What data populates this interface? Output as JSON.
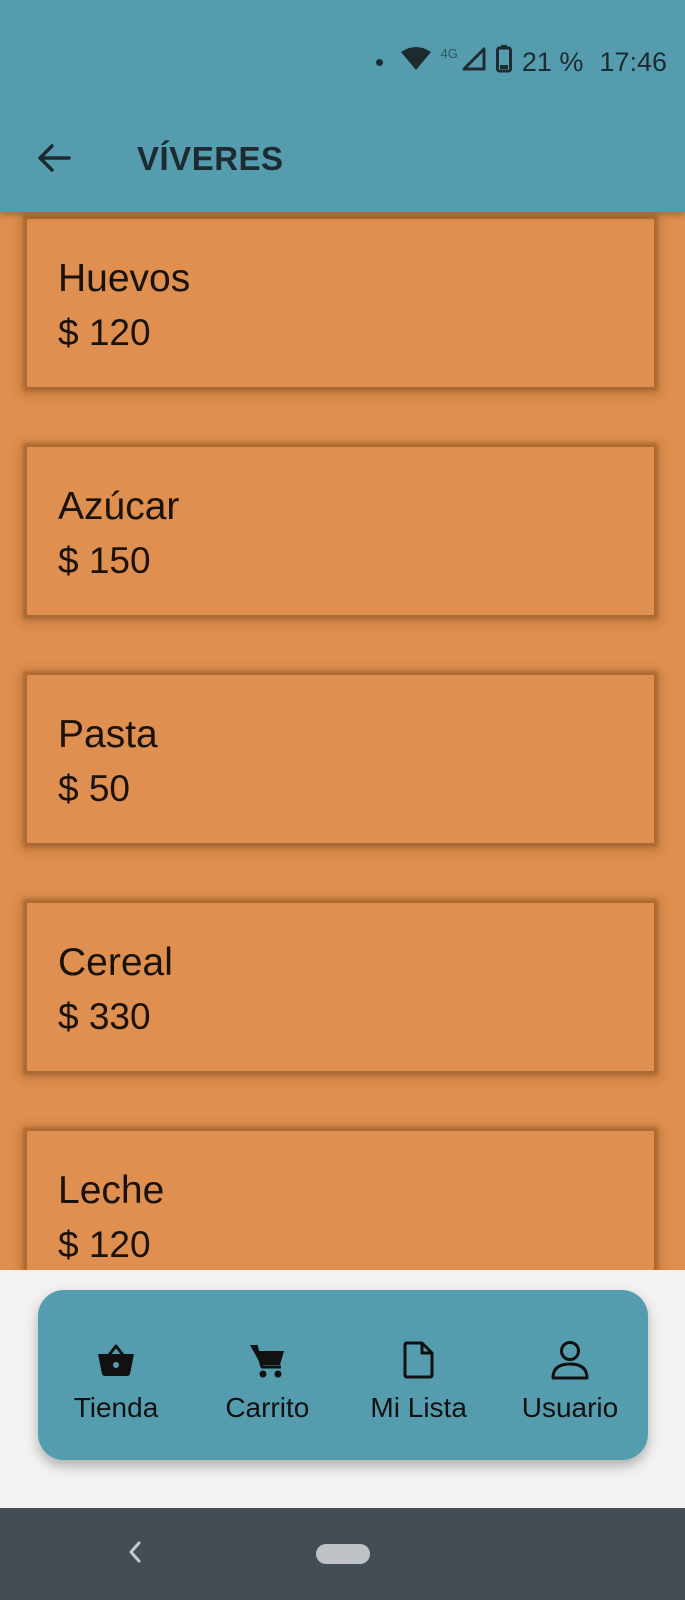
{
  "status_bar": {
    "network_label": "4G",
    "battery_percent": "21 %",
    "time": "17:46",
    "icons": [
      "notification-dot-icon",
      "wifi-icon",
      "signal-icon",
      "battery-icon"
    ]
  },
  "toolbar": {
    "back_icon": "arrow-left-icon",
    "title": "VÍVERES"
  },
  "products": [
    {
      "name": "Huevos",
      "price": "$ 120"
    },
    {
      "name": "Azúcar",
      "price": "$ 150"
    },
    {
      "name": "Pasta",
      "price": "$ 50"
    },
    {
      "name": "Cereal",
      "price": "$ 330"
    },
    {
      "name": "Leche",
      "price": "$ 120"
    }
  ],
  "bottom_nav": {
    "items": [
      {
        "label": "Tienda",
        "icon": "basket-icon"
      },
      {
        "label": "Carrito",
        "icon": "cart-icon"
      },
      {
        "label": "Mi Lista",
        "icon": "document-icon"
      },
      {
        "label": "Usuario",
        "icon": "user-icon"
      }
    ]
  },
  "system_nav": {
    "back_icon": "chevron-left-icon",
    "home_icon": "home-pill-icon"
  },
  "colors": {
    "app_bar": "#559dae",
    "card": "#df8f4f",
    "nav_background": "#f2f2f2",
    "system_nav": "#444c54"
  }
}
